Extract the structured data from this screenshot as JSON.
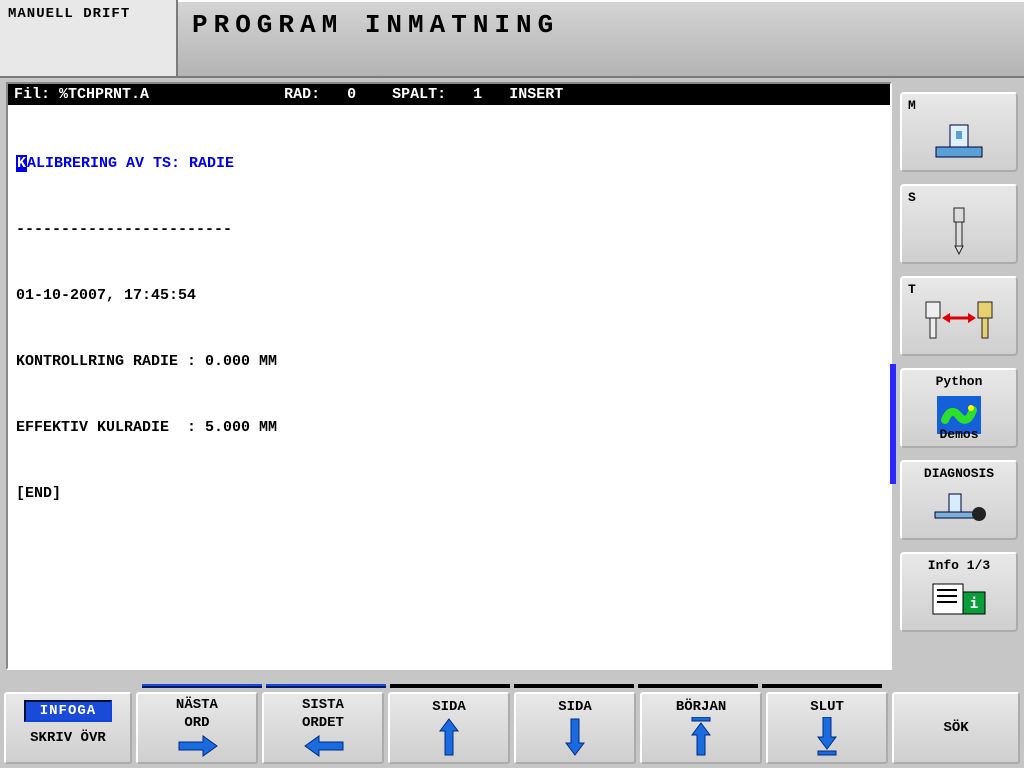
{
  "header": {
    "mode_tab": "MANUELL DRIFT",
    "title": "PROGRAM INMATNING"
  },
  "status": {
    "file_label": "Fil:",
    "file_name": "%TCHPRNT.A",
    "rad_label": "RAD:",
    "rad_value": "0",
    "spalt_label": "SPALT:",
    "spalt_value": "1",
    "mode": "INSERT"
  },
  "editor": {
    "line_highlight_char": "K",
    "line_highlight_rest": "ALIBRERING AV TS: RADIE",
    "divider": "------------------------",
    "timestamp": "01-10-2007, 17:45:54",
    "l1": "KONTROLLRING RADIE : 0.000 MM",
    "l2": "EFFEKTIV KULRADIE  : 5.000 MM",
    "end": "[END]"
  },
  "right": {
    "m": "M",
    "s": "S",
    "t": "T",
    "python_top": "Python",
    "python_bot": "Demos",
    "diag": "DIAGNOSIS",
    "info": "Info 1/3"
  },
  "bottom": {
    "infoga": "INFOGA",
    "skriv": "SKRIV ÖVR",
    "nasta1": "NÄSTA",
    "nasta2": "ORD",
    "sista1": "SISTA",
    "sista2": "ORDET",
    "sida": "SIDA",
    "borjan": "BÖRJAN",
    "slut": "SLUT",
    "sok": "SÖK"
  }
}
